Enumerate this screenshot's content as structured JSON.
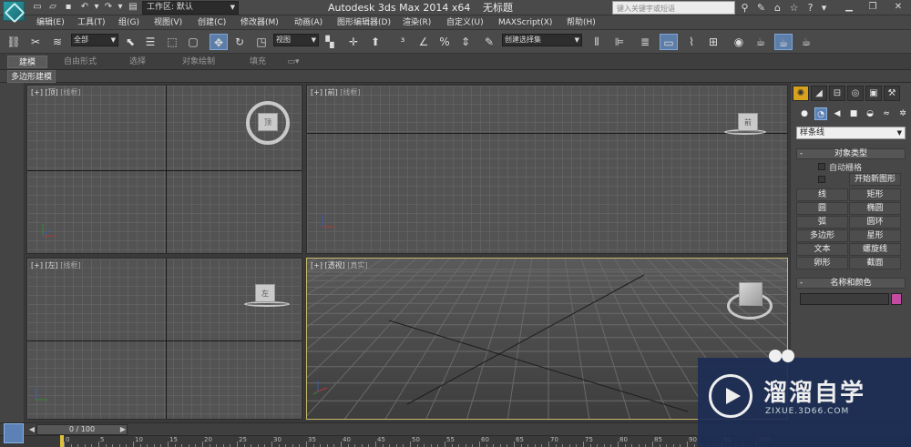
{
  "title_bar": {
    "workspace": "工作区: 默认",
    "app_title": "Autodesk 3ds Max  2014 x64",
    "document_title": "无标题",
    "search_placeholder": "键入关键字或短语"
  },
  "menu": {
    "items": [
      "编辑(E)",
      "工具(T)",
      "组(G)",
      "视图(V)",
      "创建(C)",
      "修改器(M)",
      "动画(A)",
      "图形编辑器(D)",
      "渲染(R)",
      "自定义(U)",
      "MAXScript(X)",
      "帮助(H)"
    ]
  },
  "toolbar": {
    "selection_filter": "全部",
    "reference_coord": "视图",
    "named_selection": "创建选择集"
  },
  "ribbon": {
    "tabs": [
      "建模",
      "自由形式",
      "选择",
      "对象绘制",
      "填充"
    ],
    "active_tab": "建模",
    "subpanel_label": "多边形建模"
  },
  "viewports": {
    "top": {
      "plus": "[+]",
      "name": "[顶]",
      "shading": "[线框]",
      "cube_label": "顶"
    },
    "front": {
      "plus": "[+]",
      "name": "[前]",
      "shading": "[线框]",
      "cube_label": "前"
    },
    "left": {
      "plus": "[+]",
      "name": "[左]",
      "shading": "[线框]",
      "cube_label": "左"
    },
    "perspective": {
      "plus": "[+]",
      "name": "[透视]",
      "shading": "[真实]"
    }
  },
  "command_panel": {
    "category_dropdown": "样条线",
    "object_type": {
      "header": "对象类型",
      "auto_grid": "自动栅格",
      "start_new_shape": "开始新图形",
      "buttons": [
        "线",
        "矩形",
        "圆",
        "椭圆",
        "弧",
        "圆环",
        "多边形",
        "星形",
        "文本",
        "螺旋线",
        "卵形",
        "截面"
      ]
    },
    "name_color": {
      "header": "名称和颜色",
      "color": "#c24aa0"
    }
  },
  "timeline": {
    "slider": "0 / 100",
    "ruler_labels": [
      "0",
      "5",
      "10",
      "15",
      "20",
      "25",
      "30",
      "35",
      "40",
      "45",
      "50",
      "55",
      "60",
      "65",
      "70",
      "75",
      "80",
      "85",
      "90",
      "95",
      "100"
    ]
  },
  "watermark": {
    "brand": "溜溜自学",
    "url": "ZIXUE.3D66.COM"
  }
}
